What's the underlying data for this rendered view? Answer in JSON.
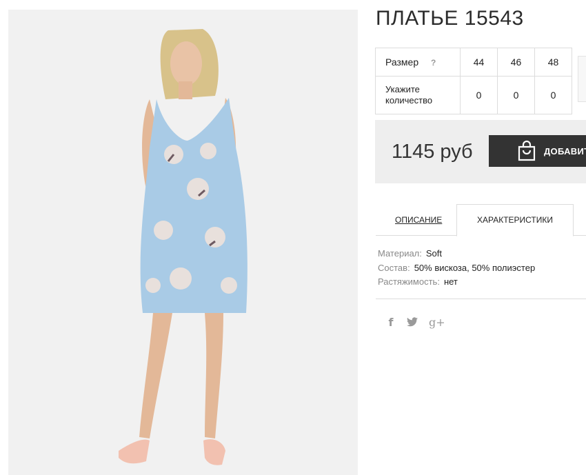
{
  "product": {
    "title": "ПЛАТЬЕ 15543",
    "image_alt": "model wearing light blue floral slip dress"
  },
  "size_table": {
    "size_label": "Размер",
    "help": "?",
    "sizes": [
      "44",
      "46",
      "48"
    ],
    "qty_label": "Укажите количество",
    "quantities": [
      "0",
      "0",
      "0"
    ]
  },
  "buy": {
    "price": "1145 руб",
    "add_label": "ДОБАВИТ"
  },
  "tabs": {
    "description": "ОПИСАНИЕ",
    "characteristics": "ХАРАКТЕРИСТИКИ",
    "active": "characteristics"
  },
  "specs": [
    {
      "key": "Материал:",
      "value": "Soft"
    },
    {
      "key": "Состав:",
      "value": "50% вискоза, 50% полиэстер"
    },
    {
      "key": "Растяжимость:",
      "value": "нет"
    }
  ],
  "social": {
    "facebook": "f",
    "twitter": "twitter-icon",
    "google": "g+"
  },
  "colors": {
    "button": "#333333",
    "buy_box": "#eeeeee",
    "dress": "#a9cbe6"
  }
}
